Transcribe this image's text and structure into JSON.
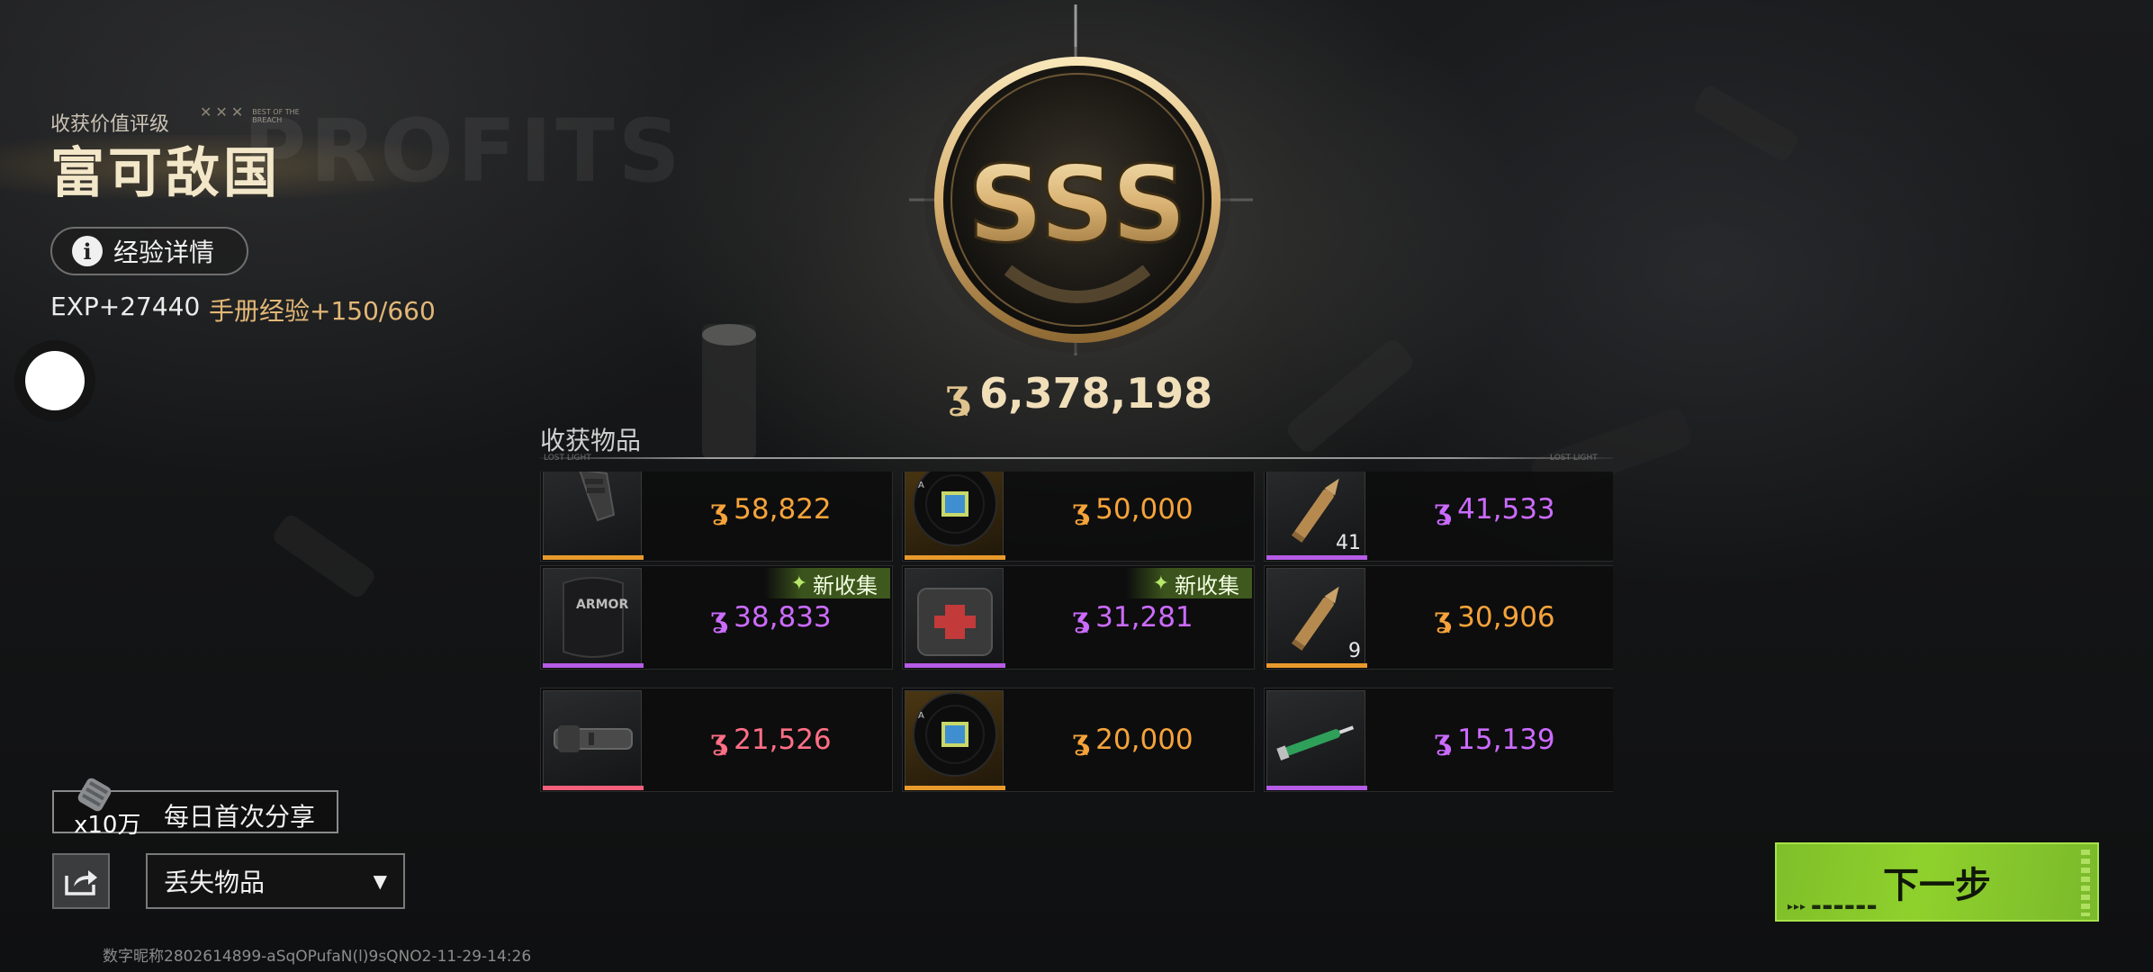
{
  "rating": {
    "subtitle": "收获价值评级",
    "best_of": "BEST OF THE BREACH",
    "title": "富可敌国",
    "watermark": "PROFITS",
    "grade": "SSS"
  },
  "exp": {
    "detail_button": "经验详情",
    "exp_text": "EXP+27440",
    "handbook_text": "手册经验+150/660"
  },
  "total": {
    "value": "6,378,198",
    "coin_glyph": "ʓ"
  },
  "items_section": {
    "label": "收获物品",
    "lost_light_left": "LOST LIGHT",
    "lost_light_right": "LOST LIGHT",
    "new_tag": "新收集",
    "rows": [
      [
        {
          "price": "58,822",
          "rarity": "orange",
          "qty": "",
          "new": false,
          "icon": "grip-icon"
        },
        {
          "price": "50,000",
          "rarity": "orange",
          "qty": "",
          "new": false,
          "icon": "record-disc-icon"
        },
        {
          "price": "41,533",
          "rarity": "purple",
          "qty": "41",
          "new": false,
          "icon": "bullet-icon"
        }
      ],
      [
        {
          "price": "38,833",
          "rarity": "purple",
          "qty": "",
          "new": true,
          "icon": "armor-plate-icon"
        },
        {
          "price": "31,281",
          "rarity": "purple",
          "qty": "",
          "new": true,
          "icon": "medical-bag-icon"
        },
        {
          "price": "30,906",
          "rarity": "orange",
          "qty": "9",
          "new": false,
          "icon": "bullet-icon"
        }
      ],
      [
        {
          "price": "21,526",
          "rarity": "pink",
          "qty": "",
          "new": false,
          "icon": "flashlight-icon"
        },
        {
          "price": "20,000",
          "rarity": "orange",
          "qty": "",
          "new": false,
          "icon": "record-disc-icon"
        },
        {
          "price": "15,139",
          "rarity": "purple",
          "qty": "",
          "new": false,
          "icon": "syringe-icon"
        }
      ]
    ]
  },
  "share": {
    "reward_count": "x10万",
    "tip_label": "每日首次分享",
    "lost_items_select": "丢失物品"
  },
  "next_button": "下一步",
  "footer_id": "数字昵称2802614899-aSqOPufaN(l)9sQNO2-11-29-14:26",
  "colors": {
    "orange": "#f5a33a",
    "purple": "#cc6bff",
    "pink": "#ff6f86",
    "accent_green": "#8fd12c",
    "gold": "#f1dfba"
  }
}
